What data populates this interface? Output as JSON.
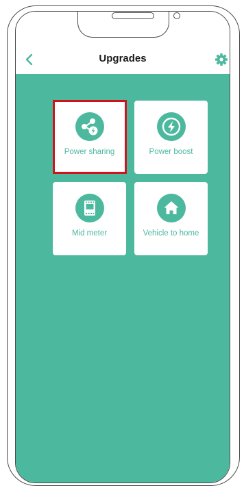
{
  "header": {
    "title": "Upgrades"
  },
  "tiles": [
    {
      "label": "Power sharing",
      "icon": "power-sharing-icon",
      "selected": true
    },
    {
      "label": "Power boost",
      "icon": "lightning-icon",
      "selected": false
    },
    {
      "label": "Mid meter",
      "icon": "meter-icon",
      "selected": false
    },
    {
      "label": "Vehicle to home",
      "icon": "home-icon",
      "selected": false
    }
  ],
  "colors": {
    "accent": "#4cb89e",
    "selection": "#d0121b",
    "background": "#ffffff"
  }
}
